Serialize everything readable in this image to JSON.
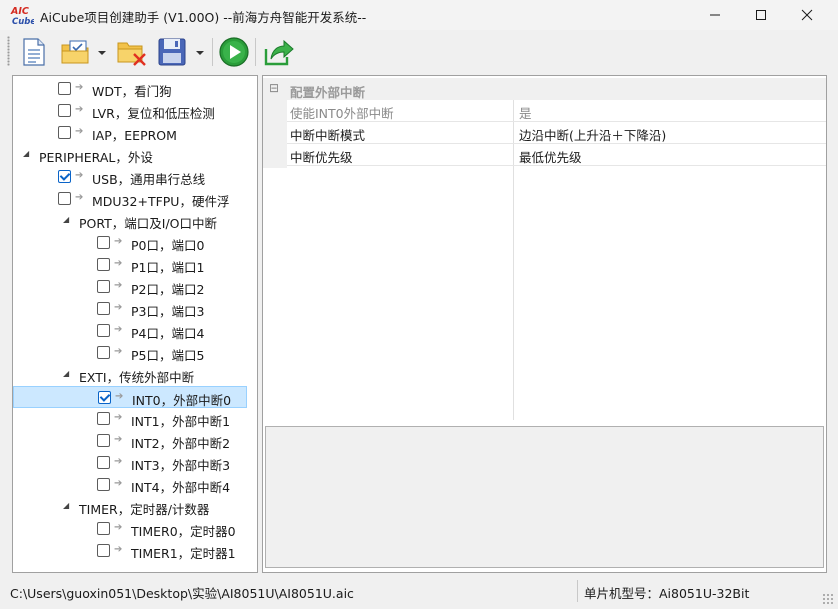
{
  "window": {
    "logo_text": "AIC\nCube",
    "title": "AiCube项目创建助手 (V1.00O) --前海方舟智能开发系统--",
    "icons": [
      "minimize-icon",
      "maximize-icon",
      "close-icon"
    ]
  },
  "toolbar": {
    "buttons": [
      {
        "name": "new-project",
        "icon": "new-document-icon"
      },
      {
        "name": "open-project",
        "icon": "open-folder-icon",
        "dropdown": true
      },
      {
        "name": "close-project",
        "icon": "close-folder-icon"
      },
      {
        "name": "save-project",
        "icon": "save-disk-icon",
        "dropdown": true
      },
      {
        "name": "run",
        "icon": "play-icon"
      },
      {
        "name": "export",
        "icon": "export-icon"
      }
    ]
  },
  "tree": {
    "nodes": [
      {
        "label": "WDT，看门狗",
        "level": 2,
        "checked": false,
        "expander": null
      },
      {
        "label": "LVR，复位和低压检测",
        "level": 2,
        "checked": false,
        "expander": null
      },
      {
        "label": "IAP，EEPROM",
        "level": 2,
        "checked": false,
        "expander": null
      },
      {
        "label": "PERIPHERAL，外设",
        "level": 0,
        "checked": null,
        "expander": "expanded"
      },
      {
        "label": "USB，通用串行总线",
        "level": 2,
        "checked": true,
        "expander": null
      },
      {
        "label": "MDU32+TFPU，硬件浮",
        "level": 2,
        "checked": false,
        "expander": null
      },
      {
        "label": "PORT，端口及I/O口中断",
        "level": 1,
        "checked": null,
        "expander": "expanded"
      },
      {
        "label": "P0口，端口0",
        "level": 3,
        "checked": false,
        "expander": null
      },
      {
        "label": "P1口，端口1",
        "level": 3,
        "checked": false,
        "expander": null
      },
      {
        "label": "P2口，端口2",
        "level": 3,
        "checked": false,
        "expander": null
      },
      {
        "label": "P3口，端口3",
        "level": 3,
        "checked": false,
        "expander": null
      },
      {
        "label": "P4口，端口4",
        "level": 3,
        "checked": false,
        "expander": null
      },
      {
        "label": "P5口，端口5",
        "level": 3,
        "checked": false,
        "expander": null
      },
      {
        "label": "EXTI，传统外部中断",
        "level": 1,
        "checked": null,
        "expander": "expanded"
      },
      {
        "label": "INT0，外部中断0",
        "level": 3,
        "checked": true,
        "expander": null,
        "selected": true
      },
      {
        "label": "INT1，外部中断1",
        "level": 3,
        "checked": false,
        "expander": null
      },
      {
        "label": "INT2，外部中断2",
        "level": 3,
        "checked": false,
        "expander": null
      },
      {
        "label": "INT3，外部中断3",
        "level": 3,
        "checked": false,
        "expander": null
      },
      {
        "label": "INT4，外部中断4",
        "level": 3,
        "checked": false,
        "expander": null
      },
      {
        "label": "TIMER，定时器/计数器",
        "level": 1,
        "checked": null,
        "expander": "expanded"
      },
      {
        "label": "TIMER0，定时器0",
        "level": 3,
        "checked": false,
        "expander": null
      },
      {
        "label": "TIMER1，定时器1",
        "level": 3,
        "checked": false,
        "expander": null
      }
    ]
  },
  "properties": {
    "category": "配置外部中断",
    "rows": [
      {
        "name": "使能INT0外部中断",
        "value": "是",
        "disabled": true
      },
      {
        "name": "中断中断模式",
        "value": "边沿中断(上升沿＋下降沿)",
        "disabled": false
      },
      {
        "name": "中断优先级",
        "value": "最低优先级",
        "disabled": false
      }
    ]
  },
  "status": {
    "path": "C:\\Users\\guoxin051\\Desktop\\实验\\AI8051U\\AI8051U.aic",
    "model": "单片机型号：Ai8051U-32Bit"
  }
}
